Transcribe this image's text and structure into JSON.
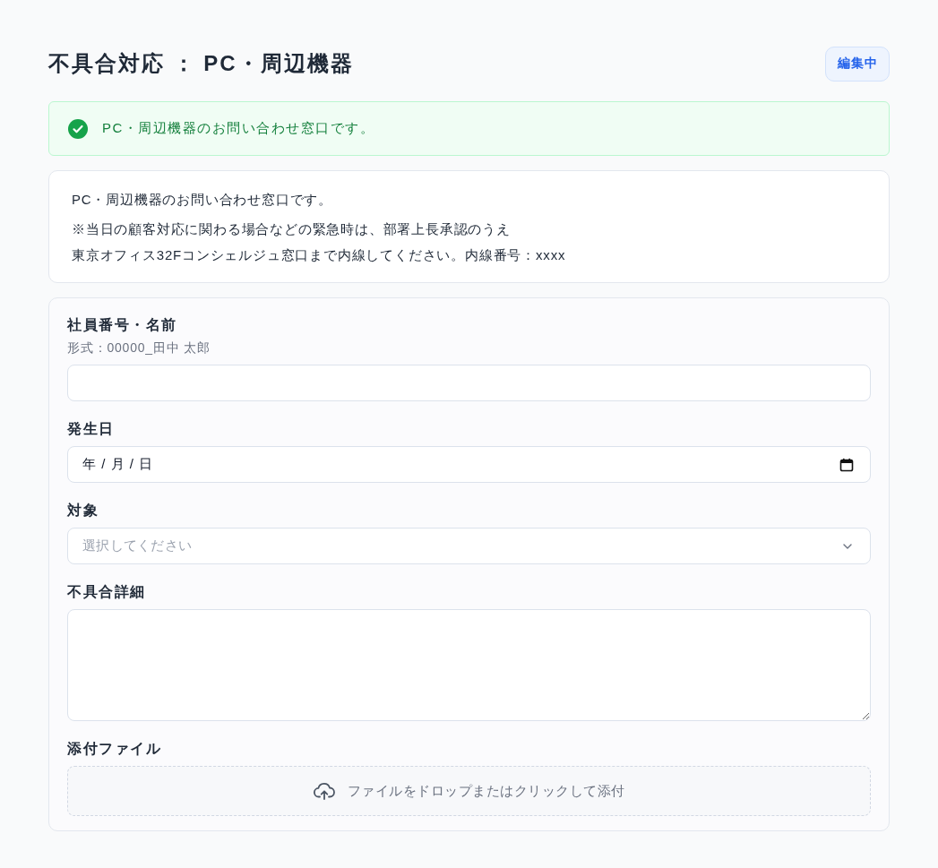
{
  "header": {
    "title": "不具合対応 ： PC・周辺機器",
    "status_badge": "編集中"
  },
  "alert": {
    "kind": "success",
    "message": "PC・周辺機器のお問い合わせ窓口です。"
  },
  "info": {
    "lines": [
      "PC・周辺機器のお問い合わせ窓口です。",
      "※当日の顧客対応に関わる場合などの緊急時は、部署上長承認のうえ",
      "東京オフィス32Fコンシェルジュ窓口まで内線してください。内線番号：xxxx"
    ]
  },
  "form": {
    "fields": [
      {
        "kind": "text",
        "label": "社員番号・名前",
        "hint": "形式：00000_田中 太郎"
      },
      {
        "kind": "date",
        "label": "発生日",
        "placeholder": "年 / 月 / 日"
      },
      {
        "kind": "select",
        "label": "対象",
        "placeholder": "選択してください"
      },
      {
        "kind": "textarea",
        "label": "不具合詳細"
      },
      {
        "kind": "file",
        "label": "添付ファイル",
        "placeholder": "ファイルをドロップまたはクリックして添付"
      }
    ]
  }
}
